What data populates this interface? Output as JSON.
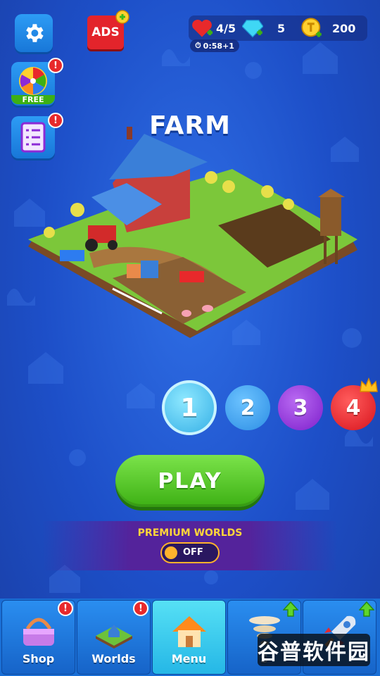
{
  "hud": {
    "lives": "4/5",
    "gems": "5",
    "coins": "200",
    "timer": "0:58+1"
  },
  "buttons": {
    "ads_label": "ADS",
    "wheel_label": "FREE"
  },
  "world": {
    "title": "FARM",
    "levels": [
      {
        "label": "1",
        "color": "#3bb6ea",
        "state": "current"
      },
      {
        "label": "2",
        "color": "#3a9ee8",
        "state": "open"
      },
      {
        "label": "3",
        "color": "#8c2ad6",
        "state": "open"
      },
      {
        "label": "4",
        "color": "#e11f27",
        "state": "boss"
      }
    ]
  },
  "play_label": "PLAY",
  "premium": {
    "label": "PREMIUM WORLDS",
    "toggle_state": "OFF"
  },
  "tabs": [
    {
      "label": "Shop",
      "icon": "basket-icon",
      "badge": "!"
    },
    {
      "label": "Worlds",
      "icon": "island-icon",
      "badge": "!"
    },
    {
      "label": "Menu",
      "icon": "house-icon",
      "active": true
    },
    {
      "label": "S",
      "icon": "tornado-icon",
      "upgrade": true
    },
    {
      "label": "",
      "icon": "rocket-icon",
      "upgrade": true
    }
  ],
  "watermark": "谷普软件园",
  "colors": {
    "background": "#1d4fc8",
    "play": "#4cc41f",
    "premium_text": "#ffd53a",
    "badge": "#e8292b"
  }
}
